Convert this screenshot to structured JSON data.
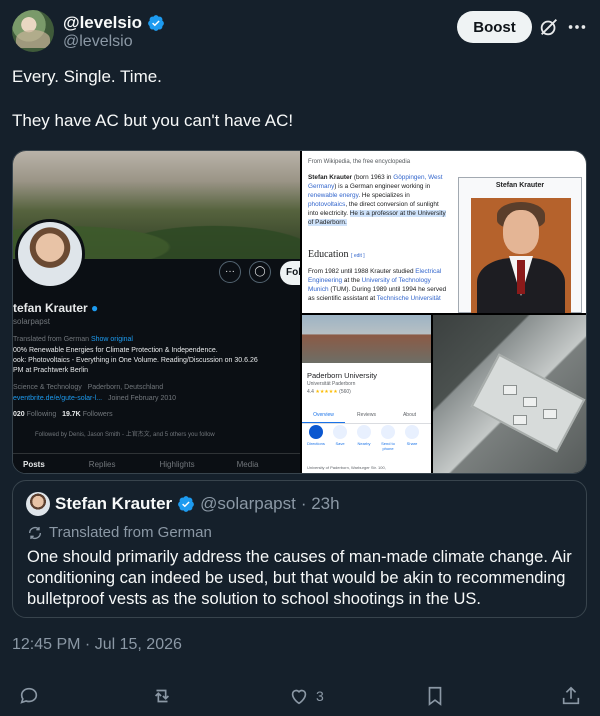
{
  "header": {
    "display_name": "@levelsio",
    "handle": "@levelsio",
    "boost_label": "Boost"
  },
  "tweet": {
    "lines": [
      "Every. Single. Time.",
      "They have AC but you can't have AC!"
    ]
  },
  "media": {
    "profile": {
      "name": "tefan Krauter",
      "handle": "solarpapst",
      "follow_label": "Follow",
      "translated": "Translated from German",
      "show_original": "Show original",
      "bio_line1": "00% Renewable Energies for Climate Protection & Independence.",
      "bio_line2": "ook: Photovoltaics - Everything in One Volume. Reading/Discussion on 30.6.26",
      "bio_line3": "PM at Prachtwerk Berlin",
      "category": "Science & Technology",
      "location": "Paderborn, Deutschland",
      "link": "eventbrite.de/e/gute-solar-l...",
      "joined": "Joined February 2010",
      "following_count": "020",
      "following_label": "Following",
      "followers_count": "19.7K",
      "followers_label": "Followers",
      "followed_by": "Followed by Denis, Jason Smith - 上官杰文, and 5 others you follow",
      "tabs": [
        "Posts",
        "Replies",
        "Highlights",
        "Media"
      ]
    },
    "wiki": {
      "source": "From Wikipedia, the free encyclopedia",
      "para1_a": "Stefan Krauter",
      "para1_b": " (born 1963 in ",
      "para1_link1": "Göppingen, West Germany",
      "para1_c": ") is a German engineer working in ",
      "para1_link2": "renewable energy",
      "para1_d": ". He specializes in ",
      "para1_link3": "photovoltaics",
      "para1_e": ", the direct conversion of sunlight into electricity. ",
      "para1_hl": "He is a professor at the University of Paderborn.",
      "heading": "Education",
      "edit": "[ edit ]",
      "para2_a": "From 1982 until 1988 Krauter studied ",
      "para2_link1": "Electrical Engineering",
      "para2_b": " at the ",
      "para2_link2": "University of Technology Munich",
      "para2_c": " (TUM). During 1989 until 1994 he served as scientific assistant at ",
      "para2_link3": "Technische Universität",
      "infobox_title": "Stefan Krauter"
    },
    "maps": {
      "title": "Paderborn University",
      "subtitle": "Universität Paderborn",
      "rating": "4.4",
      "stars": "★★★★★",
      "reviews": "(560)",
      "tabs": [
        "Overview",
        "Reviews",
        "About"
      ],
      "actions": [
        "Directions",
        "Save",
        "Nearby",
        "Send to phone",
        "Share"
      ],
      "address": "University of Paderborn, Warburger Str. 100,"
    }
  },
  "quote": {
    "name": "Stefan Krauter",
    "handle": "@solarpapst",
    "time": "· 23h",
    "translated": "Translated from German",
    "text": "One should primarily address the causes of man-made climate change. Air conditioning can indeed be used, but that would be akin to recommending bulletproof vests as the solution to school shootings in the US."
  },
  "timestamp": "12:45 PM · Jul 15, 2026",
  "actions": {
    "like_count": "3"
  },
  "colors": {
    "background": "#15202b",
    "accent": "#1d9bf0",
    "muted": "#8b98a5"
  }
}
